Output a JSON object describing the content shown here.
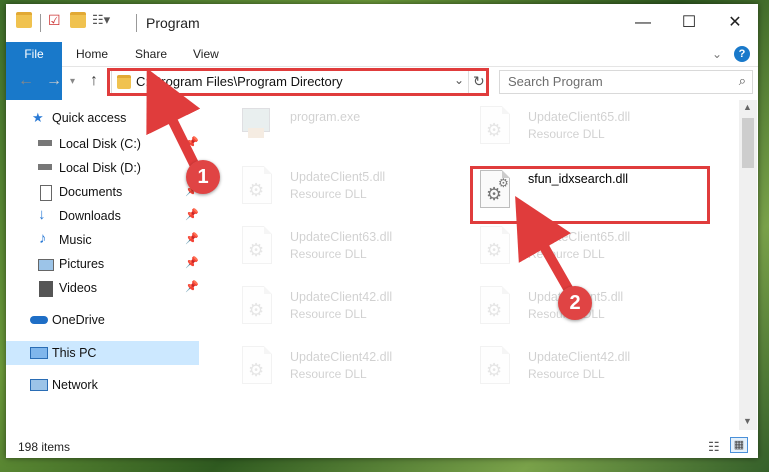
{
  "window": {
    "title": "Program"
  },
  "titlebar": {
    "minimize": "—",
    "maximize": "☐",
    "close": "✕"
  },
  "ribbon": {
    "tabs": [
      "File",
      "Home",
      "Share",
      "View"
    ],
    "help": "?"
  },
  "nav": {
    "address": "C:\\Program Files\\Program Directory",
    "search_placeholder": "Search Program"
  },
  "sidebar": {
    "quick_access": "Quick access",
    "items": [
      {
        "label": "Local Disk (C:)",
        "icon": "drive-icon"
      },
      {
        "label": "Local Disk (D:)",
        "icon": "drive-icon"
      },
      {
        "label": "Documents",
        "icon": "documents-icon"
      },
      {
        "label": "Downloads",
        "icon": "downloads-icon"
      },
      {
        "label": "Music",
        "icon": "music-icon"
      },
      {
        "label": "Pictures",
        "icon": "pictures-icon"
      },
      {
        "label": "Videos",
        "icon": "videos-icon"
      }
    ],
    "onedrive": "OneDrive",
    "thispc": "This PC",
    "network": "Network"
  },
  "files": {
    "col1": [
      {
        "name": "program.exe",
        "type": ""
      },
      {
        "name": "UpdateClient5.dll",
        "type": "Resource DLL"
      },
      {
        "name": "UpdateClient63.dll",
        "type": "Resource DLL"
      },
      {
        "name": "UpdateClient42.dll",
        "type": "Resource DLL"
      },
      {
        "name": "UpdateClient42.dll",
        "type": "Resource DLL"
      }
    ],
    "col2": [
      {
        "name": "UpdateClient65.dll",
        "type": "Resource DLL"
      },
      {
        "name": "sfun_idxsearch.dll",
        "type": ""
      },
      {
        "name": "UpdateClient65.dll",
        "type": "Resource DLL"
      },
      {
        "name": "UpdateClient5.dll",
        "type": "Resource DLL"
      },
      {
        "name": "UpdateClient42.dll",
        "type": "Resource DLL"
      }
    ]
  },
  "annotations": {
    "step1": "1",
    "step2": "2",
    "color": "#e03c3c"
  },
  "status": {
    "count": "198 items"
  }
}
